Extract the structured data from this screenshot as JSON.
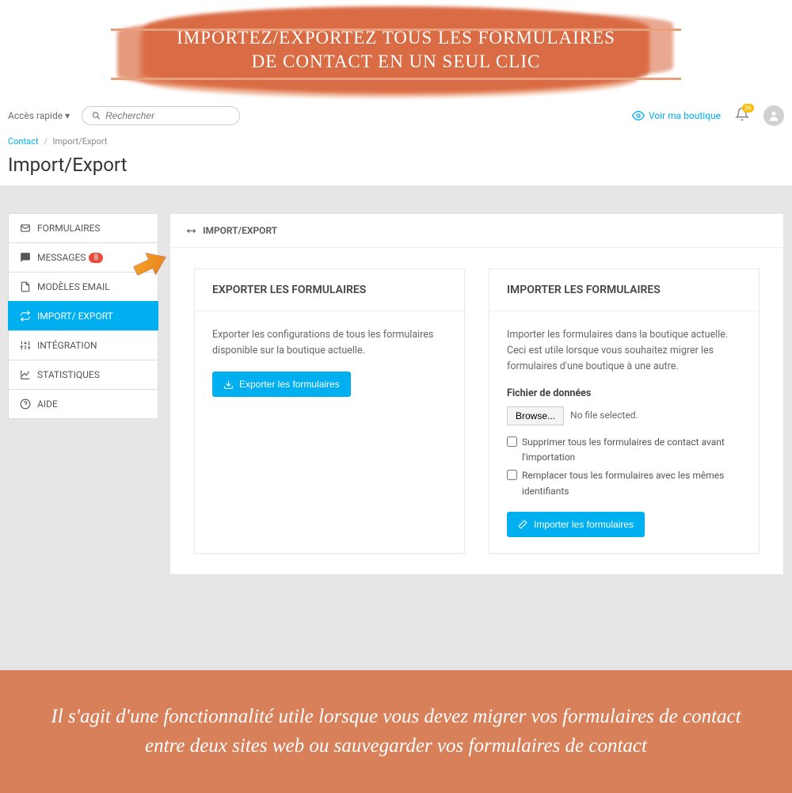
{
  "promo": {
    "title": "IMPORTEZ/EXPORTEZ TOUS LES FORMULAIRES\nDE CONTACT EN UN SEUL CLIC"
  },
  "topbar": {
    "quick_access": "Accès rapide",
    "search_placeholder": "Rechercher",
    "view_shop": "Voir ma boutique",
    "bell_count": "36"
  },
  "breadcrumb": {
    "root": "Contact",
    "current": "Import/Export"
  },
  "page": {
    "title": "Import/Export",
    "help_label": "Aide"
  },
  "sidebar": {
    "items": [
      {
        "label": "FORMULAIRES",
        "icon": "mail"
      },
      {
        "label": "MESSAGES",
        "icon": "chat",
        "badge": "8"
      },
      {
        "label": "MODÈLES EMAIL",
        "icon": "doc"
      },
      {
        "label": "IMPORT/ EXPORT",
        "icon": "swap",
        "active": true
      },
      {
        "label": "INTÉGRATION",
        "icon": "sliders"
      },
      {
        "label": "STATISTIQUES",
        "icon": "chart"
      },
      {
        "label": "AIDE",
        "icon": "question"
      }
    ],
    "active": "IMPORT/ EXPORT"
  },
  "content": {
    "header": "IMPORT/EXPORT",
    "export": {
      "title": "EXPORTER LES FORMULAIRES",
      "desc": "Exporter les configurations de tous les formulaires disponible sur la boutique actuelle.",
      "button": "Exporter les formulaires"
    },
    "import": {
      "title": "IMPORTER LES FORMULAIRES",
      "desc": "Importer les formulaires dans la boutique actuelle. Ceci est utile lorsque vous souhaitez migrer les formulaires d'une boutique à une autre.",
      "file_label": "Fichier de données",
      "browse": "Browse...",
      "no_file": "No file selected.",
      "check1": "Supprimer tous les formulaires de contact avant l'importation",
      "check2": "Remplacer tous les formulaires avec les mêmes identifiants",
      "button": "Importer les formulaires"
    }
  },
  "footer": {
    "text": "Il s'agit d'une fonctionnalité utile lorsque vous devez migrer vos formulaires de contact entre deux sites web ou sauvegarder vos formulaires de contact"
  }
}
